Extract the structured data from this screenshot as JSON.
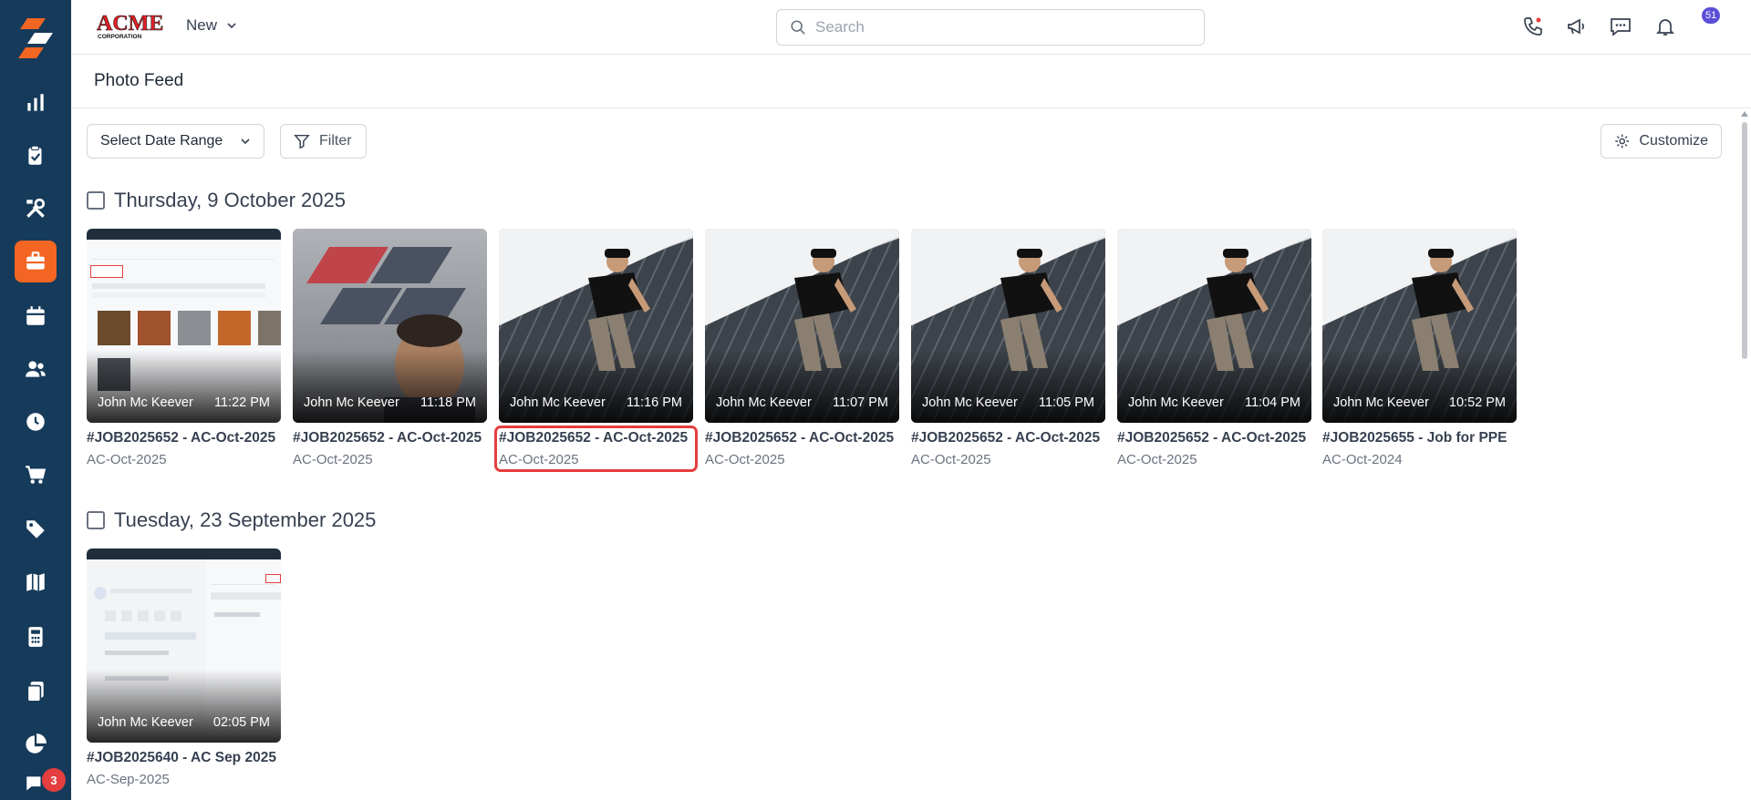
{
  "app": {
    "brand": "ACME CORPORATION"
  },
  "header": {
    "new_label": "New",
    "search_placeholder": "Search",
    "notifications_count": "51"
  },
  "sidebar": {
    "chat_badge": "3"
  },
  "page": {
    "title": "Photo Feed",
    "date_range_label": "Select Date Range",
    "filter_label": "Filter",
    "customize_label": "Customize"
  },
  "groups": [
    {
      "date": "Thursday, 9 October 2025",
      "items": [
        {
          "author": "John Mc Keever",
          "time": "11:22 PM",
          "title": "#JOB2025652 - AC-Oct-2025",
          "sub": "AC-Oct-2025",
          "kind": "screenshot"
        },
        {
          "author": "John Mc Keever",
          "time": "11:18 PM",
          "title": "#JOB2025652 - AC-Oct-2025",
          "sub": "AC-Oct-2025",
          "kind": "selfie"
        },
        {
          "author": "John Mc Keever",
          "time": "11:16 PM",
          "title": "#JOB2025652 - AC-Oct-2025",
          "sub": "AC-Oct-2025",
          "kind": "roof"
        },
        {
          "author": "John Mc Keever",
          "time": "11:07 PM",
          "title": "#JOB2025652 - AC-Oct-2025",
          "sub": "AC-Oct-2025",
          "kind": "roof"
        },
        {
          "author": "John Mc Keever",
          "time": "11:05 PM",
          "title": "#JOB2025652 - AC-Oct-2025",
          "sub": "AC-Oct-2025",
          "kind": "roof"
        },
        {
          "author": "John Mc Keever",
          "time": "11:04 PM",
          "title": "#JOB2025652 - AC-Oct-2025",
          "sub": "AC-Oct-2025",
          "kind": "roof"
        },
        {
          "author": "John Mc Keever",
          "time": "10:52 PM",
          "title": "#JOB2025655 - Job for PPE",
          "sub": "AC-Oct-2024",
          "kind": "roof"
        }
      ]
    },
    {
      "date": "Tuesday, 23 September 2025",
      "items": [
        {
          "author": "John Mc Keever",
          "time": "02:05 PM",
          "title": "#JOB2025640 - AC Sep 2025",
          "sub": "AC-Sep-2025",
          "kind": "screenshot2"
        }
      ]
    }
  ],
  "colors": {
    "sidebar": "#163a5a",
    "active": "#f26522",
    "highlight": "#e53e3e",
    "badge": "#5b4fd6"
  }
}
